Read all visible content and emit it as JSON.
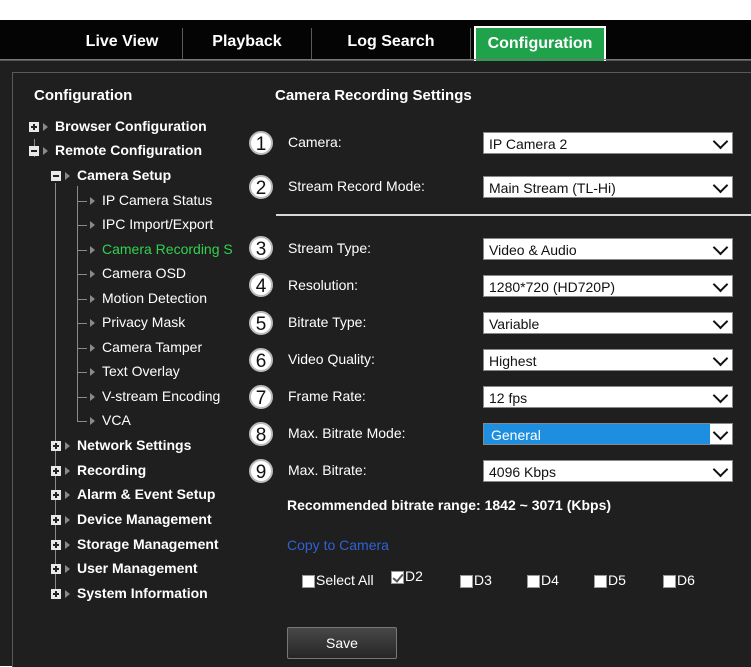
{
  "nav": {
    "tabs": [
      {
        "label": "Live View"
      },
      {
        "label": "Playback"
      },
      {
        "label": "Log Search"
      },
      {
        "label": "Configuration"
      }
    ],
    "active_tab": "Configuration"
  },
  "sidebar": {
    "title": "Configuration",
    "items": [
      {
        "label": "Browser Configuration"
      },
      {
        "label": "Remote Configuration"
      },
      {
        "label": "Camera Setup"
      },
      {
        "label": "IP Camera Status"
      },
      {
        "label": "IPC Import/Export"
      },
      {
        "label": "Camera Recording S"
      },
      {
        "label": "Camera OSD"
      },
      {
        "label": "Motion Detection"
      },
      {
        "label": "Privacy Mask"
      },
      {
        "label": "Camera Tamper"
      },
      {
        "label": "Text Overlay"
      },
      {
        "label": "V-stream Encoding"
      },
      {
        "label": "VCA"
      },
      {
        "label": "Network Settings"
      },
      {
        "label": "Recording"
      },
      {
        "label": "Alarm & Event Setup"
      },
      {
        "label": "Device Management"
      },
      {
        "label": "Storage Management"
      },
      {
        "label": "User Management"
      },
      {
        "label": "System Information"
      }
    ]
  },
  "panel": {
    "title": "Camera Recording Settings",
    "fields": [
      {
        "num": "1",
        "label": "Camera:",
        "value": "IP Camera 2"
      },
      {
        "num": "2",
        "label": "Stream Record Mode:",
        "value": "Main Stream (TL-Hi)"
      },
      {
        "num": "3",
        "label": "Stream Type:",
        "value": "Video & Audio"
      },
      {
        "num": "4",
        "label": "Resolution:",
        "value": "1280*720 (HD720P)"
      },
      {
        "num": "5",
        "label": "Bitrate Type:",
        "value": "Variable"
      },
      {
        "num": "6",
        "label": "Video Quality:",
        "value": "Highest"
      },
      {
        "num": "7",
        "label": "Frame Rate:",
        "value": "12 fps"
      },
      {
        "num": "8",
        "label": "Max. Bitrate Mode:",
        "value": "General"
      },
      {
        "num": "9",
        "label": "Max. Bitrate:",
        "value": "4096 Kbps"
      }
    ],
    "recommended": "Recommended bitrate range: 1842 ~ 3071 (Kbps)",
    "copy_label": "Copy to Camera",
    "checkboxes": [
      {
        "label": "Select All",
        "checked": false
      },
      {
        "label": "D2",
        "checked": true
      },
      {
        "label": "D3",
        "checked": false
      },
      {
        "label": "D4",
        "checked": false
      },
      {
        "label": "D5",
        "checked": false
      },
      {
        "label": "D6",
        "checked": false
      }
    ],
    "save_label": "Save"
  },
  "colors": {
    "active_tab": "#1fa24a",
    "active_tree_item": "#2fd34f",
    "highlight_select": "#1e8fe0",
    "copy_link": "#2f62d4",
    "background": "#1f1f1f"
  }
}
